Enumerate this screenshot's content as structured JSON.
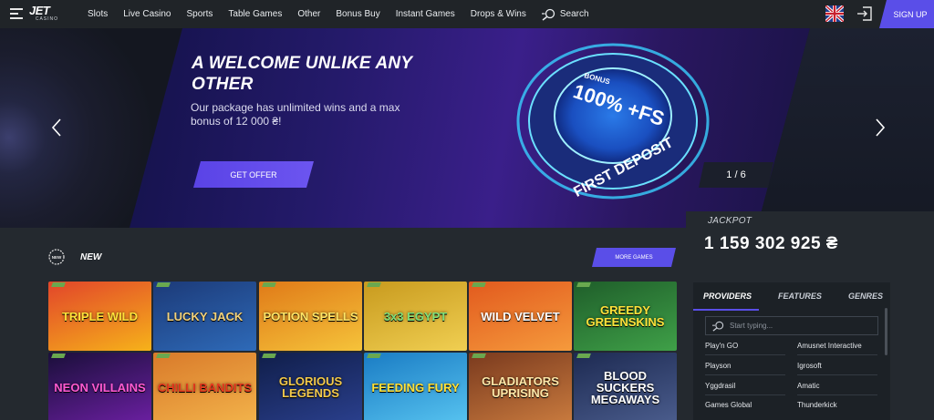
{
  "brand": {
    "logo_main": "JET",
    "logo_sub": "CASINO"
  },
  "nav": {
    "items": [
      "Slots",
      "Live Casino",
      "Sports",
      "Table Games",
      "Other",
      "Bonus Buy",
      "Instant Games",
      "Drops & Wins"
    ],
    "search_label": "Search"
  },
  "header": {
    "signup_label": "SIGN UP"
  },
  "hero": {
    "title": "A WELCOME UNLIKE ANY OTHER",
    "text": "Our package has unlimited wins and a max bonus of 12 000 ₴!",
    "cta_label": "GET OFFER",
    "badge_small": "BONUS",
    "badge_big": "100% +FS",
    "badge_arc": "FIRST DEPOSIT",
    "slide_counter": "1 / 6"
  },
  "jackpot": {
    "label": "JACKPOT",
    "value": "1 159 302 925 ₴"
  },
  "new_section": {
    "icon_text": "NEW",
    "label": "NEW",
    "more_label": "MORE GAMES"
  },
  "games": [
    {
      "title": "TRIPLE WILD",
      "color1": "#e2452a",
      "color2": "#f6b21a",
      "text": "#ffe23a"
    },
    {
      "title": "LUCKY JACK",
      "color1": "#1c3a78",
      "color2": "#2e6ab8",
      "text": "#f3d27a"
    },
    {
      "title": "POTION SPELLS",
      "color1": "#e07a18",
      "color2": "#f5c33a",
      "text": "#ffe566"
    },
    {
      "title": "3x3 EGYPT",
      "color1": "#c89a1e",
      "color2": "#f0cf52",
      "text": "#7fe07a"
    },
    {
      "title": "WILD VELVET",
      "color1": "#e25a1e",
      "color2": "#f59a3c",
      "text": "#ffffff"
    },
    {
      "title": "GREEDY GREENSKINS",
      "color1": "#1f5e2a",
      "color2": "#3fa048",
      "text": "#ffe23a"
    },
    {
      "title": "NEON VILLAINS",
      "color1": "#1a0f3a",
      "color2": "#6a1fa0",
      "text": "#ff5ad1"
    },
    {
      "title": "CHILLI BANDITS",
      "color1": "#d97a2a",
      "color2": "#f2b24a",
      "text": "#e83a1e"
    },
    {
      "title": "GLORIOUS LEGENDS",
      "color1": "#101e4a",
      "color2": "#2a3f8c",
      "text": "#f3c94a"
    },
    {
      "title": "FEEDING FURY",
      "color1": "#1a7cc4",
      "color2": "#56c2ef",
      "text": "#ffe23a"
    },
    {
      "title": "GLADIATORS UPRISING",
      "color1": "#7a3a1e",
      "color2": "#c87a3e",
      "text": "#ffe8a8"
    },
    {
      "title": "BLOOD SUCKERS MEGAWAYS",
      "color1": "#1d2a52",
      "color2": "#4a5c8c",
      "text": "#ffffff"
    }
  ],
  "providers": {
    "tabs": [
      "PROVIDERS",
      "FEATURES",
      "GENRES"
    ],
    "search_placeholder": "Start typing...",
    "left": [
      "Play'n GO",
      "Playson",
      "Yggdrasil",
      "Games Global"
    ],
    "right": [
      "Amusnet Interactive",
      "Igrosoft",
      "Amatic",
      "Thunderkick"
    ]
  },
  "colors": {
    "accent": "#5a4ee8",
    "header_bg": "#202428",
    "page_bg": "#24292f"
  }
}
